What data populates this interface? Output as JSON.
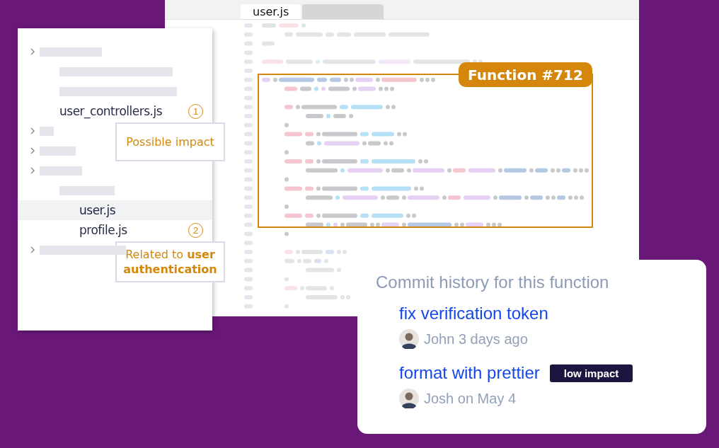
{
  "editor": {
    "tabs": [
      {
        "label": "user.js",
        "selected": true
      }
    ],
    "function_label": "Function #712"
  },
  "file_tree": {
    "items": [
      {
        "kind": "folder",
        "children": [
          {
            "kind": "placeholder"
          },
          {
            "kind": "placeholder"
          },
          {
            "kind": "file",
            "label": "user_controllers.js",
            "selected": false,
            "marker": "1",
            "note": "Possible impact"
          }
        ]
      },
      {
        "kind": "folder"
      },
      {
        "kind": "folder"
      },
      {
        "kind": "folder",
        "children": [
          {
            "kind": "placeholder",
            "children": [
              {
                "kind": "file",
                "label": "user.js",
                "selected": true
              },
              {
                "kind": "file",
                "label": "profile.js",
                "selected": false,
                "marker": "2",
                "note": "Related to **user authentication**"
              }
            ]
          }
        ]
      },
      {
        "kind": "folder"
      }
    ]
  },
  "commit_history": {
    "title": "Commit history for this function",
    "commits": [
      {
        "title": "fix verification token",
        "meta": "John 3 days ago"
      },
      {
        "title": "format with prettier",
        "badge": "low impact",
        "meta": "Josh on May 4"
      }
    ]
  }
}
